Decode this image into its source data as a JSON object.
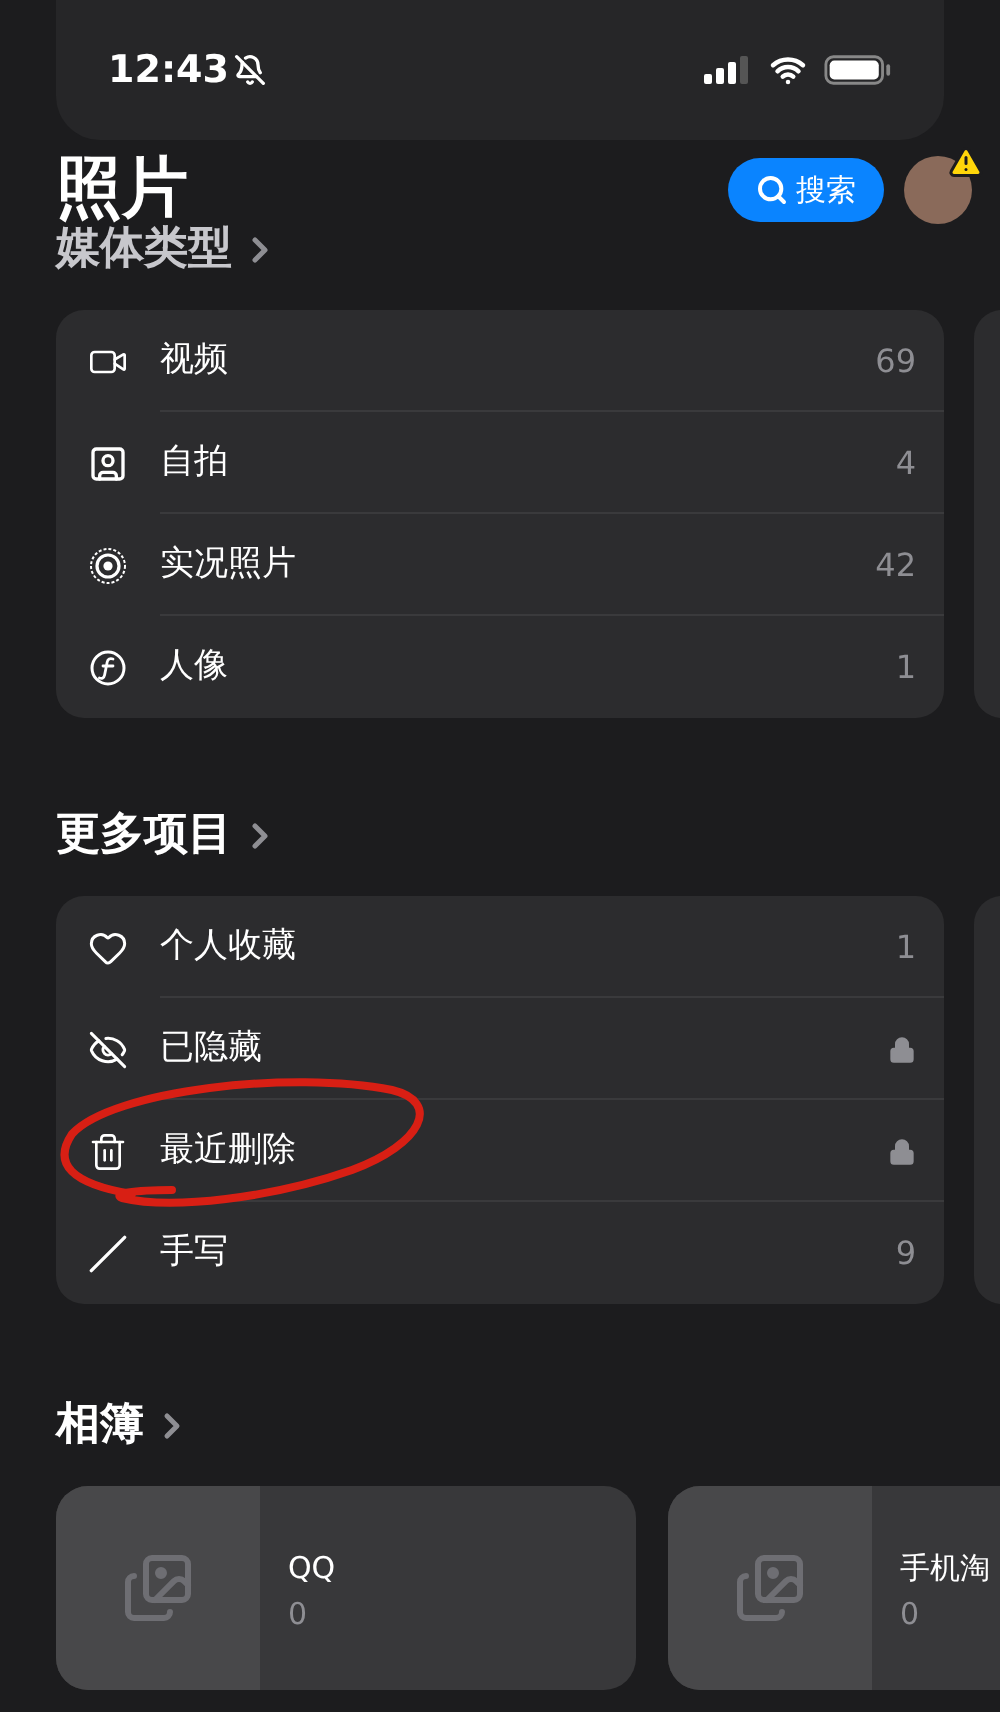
{
  "status_bar": {
    "time": "12:43",
    "silent": true
  },
  "header": {
    "title": "照片",
    "search_button": "搜索",
    "avatar_warning": true
  },
  "sections": [
    {
      "title": "媒体类型",
      "items": [
        {
          "label": "视频",
          "kind": "count",
          "value": "69"
        },
        {
          "label": "自拍",
          "kind": "count",
          "value": "4"
        },
        {
          "label": "实况照片",
          "kind": "count",
          "value": "42"
        },
        {
          "label": "人像",
          "kind": "count",
          "value": "1"
        }
      ]
    },
    {
      "title": "更多项目",
      "items": [
        {
          "label": "个人收藏",
          "kind": "count",
          "value": "1"
        },
        {
          "label": "已隐藏",
          "kind": "locked"
        },
        {
          "label": "最近删除",
          "kind": "locked",
          "annotated": true
        },
        {
          "label": "手写",
          "kind": "count",
          "value": "9"
        }
      ]
    }
  ],
  "albums": {
    "title": "相簿",
    "items": [
      {
        "name": "QQ",
        "count": "0"
      },
      {
        "name": "手机淘",
        "count": "0"
      }
    ]
  }
}
